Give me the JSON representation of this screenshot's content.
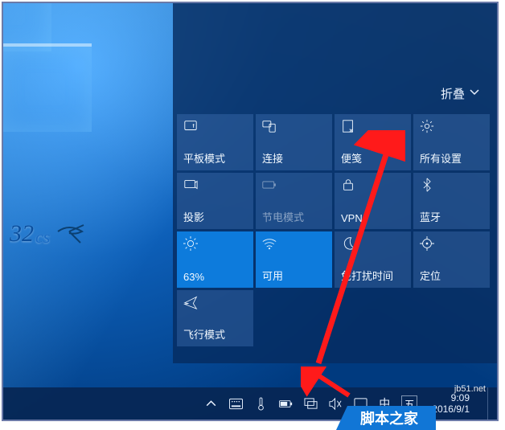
{
  "actionCenter": {
    "collapse_label": "折叠",
    "tiles": [
      {
        "label": "平板模式",
        "icon": "tablet"
      },
      {
        "label": "连接",
        "icon": "connect"
      },
      {
        "label": "便笺",
        "icon": "note"
      },
      {
        "label": "所有设置",
        "icon": "gear"
      },
      {
        "label": "投影",
        "icon": "project"
      },
      {
        "label": "节电模式",
        "icon": "battery",
        "state": "disabled"
      },
      {
        "label": "VPN",
        "icon": "vpn"
      },
      {
        "label": "蓝牙",
        "icon": "bluetooth"
      },
      {
        "label": "63%",
        "icon": "brightness",
        "state": "active"
      },
      {
        "label": "可用",
        "icon": "wifi",
        "state": "active"
      },
      {
        "label": "免打扰时间",
        "icon": "moon"
      },
      {
        "label": "定位",
        "icon": "location"
      },
      {
        "label": "飞行模式",
        "icon": "airplane"
      }
    ]
  },
  "taskbar": {
    "ime_lang": "中",
    "ime_mode": "五",
    "time": "9:09",
    "date": "2016/9/1"
  },
  "annotations": {
    "source_watermark": "jb51.net",
    "footer_text": "脚本之家"
  }
}
